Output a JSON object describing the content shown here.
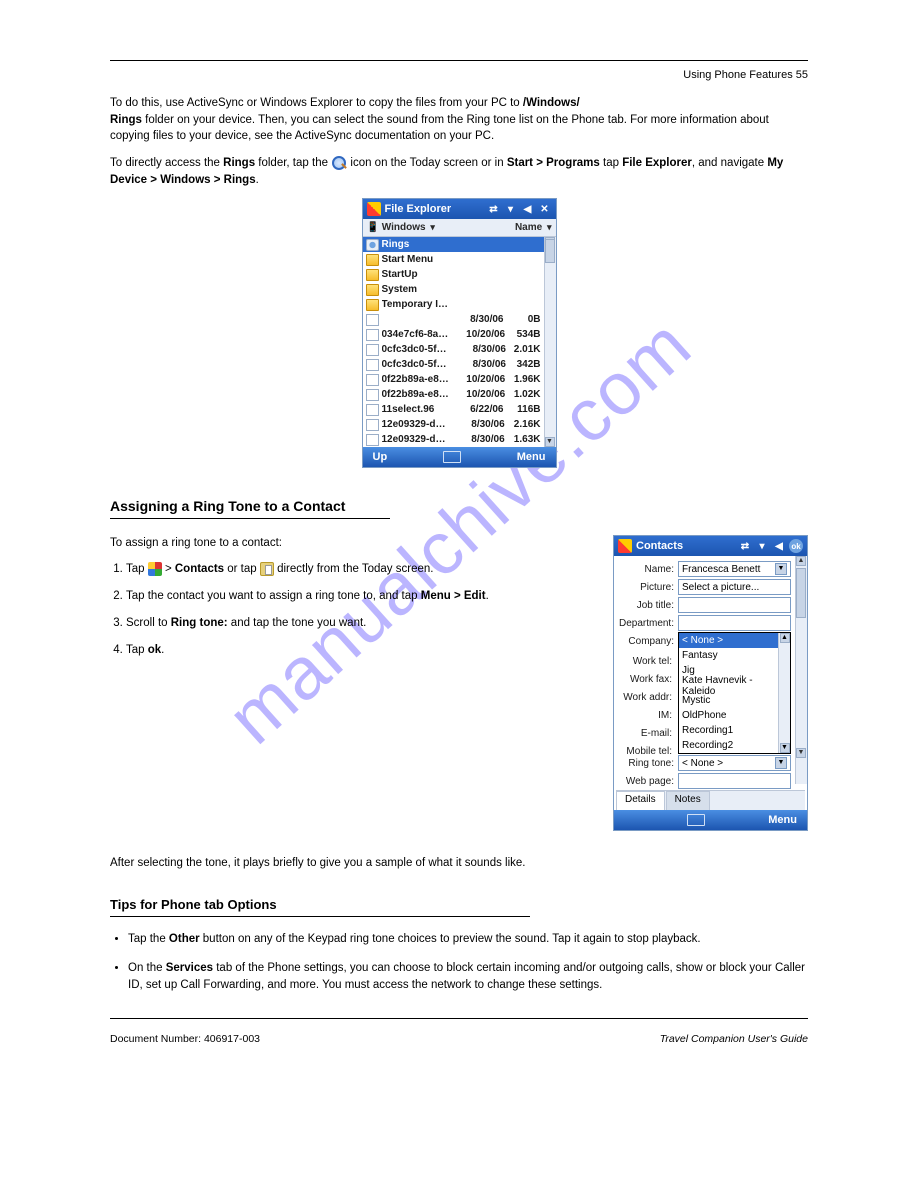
{
  "header": {
    "right_text": "Using Phone Features  55"
  },
  "intro": {
    "line1_pre": "To do this, use ActiveSync or Windows Explorer to copy the files from your PC to ",
    "line1_bold": "/Windows/",
    "line2_bold": "Rings",
    "line2_rest": " folder on your device. Then, you can select the sound from the Ring tone list on the Phone tab. For more information about copying files to your device, see the ActiveSync documentation on your PC.",
    "line3_pre": "To directly access the ",
    "line3_bold": "Rings",
    "line3_rest": " folder, tap the ",
    "line3_icon_label": "Search",
    "line3_after_icon": " icon on the Today screen or in ",
    "line3_bold2": "Start > Programs",
    "line3_after_bold2": " tap ",
    "line3_bold3": "File Explorer",
    "line3_after_bold3": ", and navigate ",
    "line3_bold4": "My Device > Windows > Rings",
    "line3_tail": "."
  },
  "file_explorer": {
    "title": "File Explorer",
    "toolbar_left": "Windows",
    "toolbar_right": "Name",
    "close_glyph": "✕",
    "rows": [
      {
        "icon": "gear",
        "name": "Rings",
        "date": "",
        "size": "",
        "selected": true
      },
      {
        "icon": "folder",
        "name": "Start Menu",
        "date": "",
        "size": ""
      },
      {
        "icon": "folder",
        "name": "StartUp",
        "date": "",
        "size": ""
      },
      {
        "icon": "folder",
        "name": "System",
        "date": "",
        "size": ""
      },
      {
        "icon": "folder",
        "name": "Temporary In...",
        "date": "",
        "size": ""
      },
      {
        "icon": "file",
        "name": "",
        "date": "8/30/06",
        "size": "0B"
      },
      {
        "icon": "file",
        "name": "034e7cf6-8a3...",
        "date": "10/20/06",
        "size": "534B"
      },
      {
        "icon": "file",
        "name": "0cfc3dc0-5fbc...",
        "date": "8/30/06",
        "size": "2.01K"
      },
      {
        "icon": "file",
        "name": "0cfc3dc0-5fbc...",
        "date": "8/30/06",
        "size": "342B"
      },
      {
        "icon": "file",
        "name": "0f22b89a-e84...",
        "date": "10/20/06",
        "size": "1.96K"
      },
      {
        "icon": "file",
        "name": "0f22b89a-e84...",
        "date": "10/20/06",
        "size": "1.02K"
      },
      {
        "icon": "file",
        "name": "11select.96",
        "date": "6/22/06",
        "size": "116B"
      },
      {
        "icon": "file",
        "name": "12e09329-dd...",
        "date": "8/30/06",
        "size": "2.16K"
      },
      {
        "icon": "file",
        "name": "12e09329-dd...",
        "date": "8/30/06",
        "size": "1.63K"
      }
    ],
    "footer_left": "Up",
    "footer_right": "Menu"
  },
  "section": {
    "title": "Assigning a Ring Tone to a Contact",
    "step_intro": "To assign a ring tone to a contact:",
    "steps": [
      {
        "pre": "Tap ",
        "bold": "",
        "mid": " > ",
        "bold2": "Contacts",
        "rest": " or tap ",
        "bold3": "",
        "rest2": " directly from the Today screen.",
        "icons": [
          "winflag",
          "contacts"
        ]
      },
      {
        "pre": "Tap the contact you want to assign a ring tone to, and tap ",
        "bold": "Menu > Edit",
        "rest": "."
      },
      {
        "pre": "Scroll to ",
        "bold": "Ring tone:",
        "rest": " and tap the tone you want."
      },
      {
        "pre": "Tap ",
        "bold": "ok",
        "rest": "."
      }
    ]
  },
  "contacts": {
    "title": "Contacts",
    "ok_label": "ok",
    "fields": {
      "name_lbl": "Name:",
      "name_val": "Francesca Benett",
      "picture_lbl": "Picture:",
      "picture_val": "Select a picture...",
      "job_lbl": "Job title:",
      "job_val": "",
      "dept_lbl": "Department:",
      "dept_val": "",
      "company_lbl": "Company:",
      "worktel_lbl": "Work tel:",
      "workfax_lbl": "Work fax:",
      "workaddr_lbl": "Work addr:",
      "im_lbl": "IM:",
      "email_lbl": "E-mail:",
      "mobile_lbl": "Mobile tel:",
      "ringtone_lbl": "Ring tone:",
      "ringtone_val": "< None >",
      "web_lbl": "Web page:"
    },
    "dropdown_options": [
      "< None >",
      "Fantasy",
      "Jig",
      "Kate Havnevik - Kaleido",
      "Mystic",
      "OldPhone",
      "Recording1",
      "Recording2"
    ],
    "tabs": {
      "details": "Details",
      "notes": "Notes"
    },
    "footer_right": "Menu"
  },
  "after_steps": "After selecting the tone, it plays briefly to give you a sample of what it sounds like.",
  "tips": {
    "title": "Tips for Phone tab Options",
    "items": [
      {
        "pre": "Tap the ",
        "bold": "Other",
        "rest": " button on any of the Keypad ring tone choices to preview the sound. Tap it again to stop playback."
      },
      {
        "pre": "On the ",
        "bold": "Services",
        "rest": " tab of the Phone settings, you can choose to block certain incoming and/or outgoing calls, show or block your Caller ID, set up Call Forwarding, and more. You must access the network to change these settings."
      }
    ]
  },
  "footer": {
    "left": "Document Number: 406917-003",
    "right": "Travel Companion User's Guide"
  },
  "watermark": "manualchive.com"
}
